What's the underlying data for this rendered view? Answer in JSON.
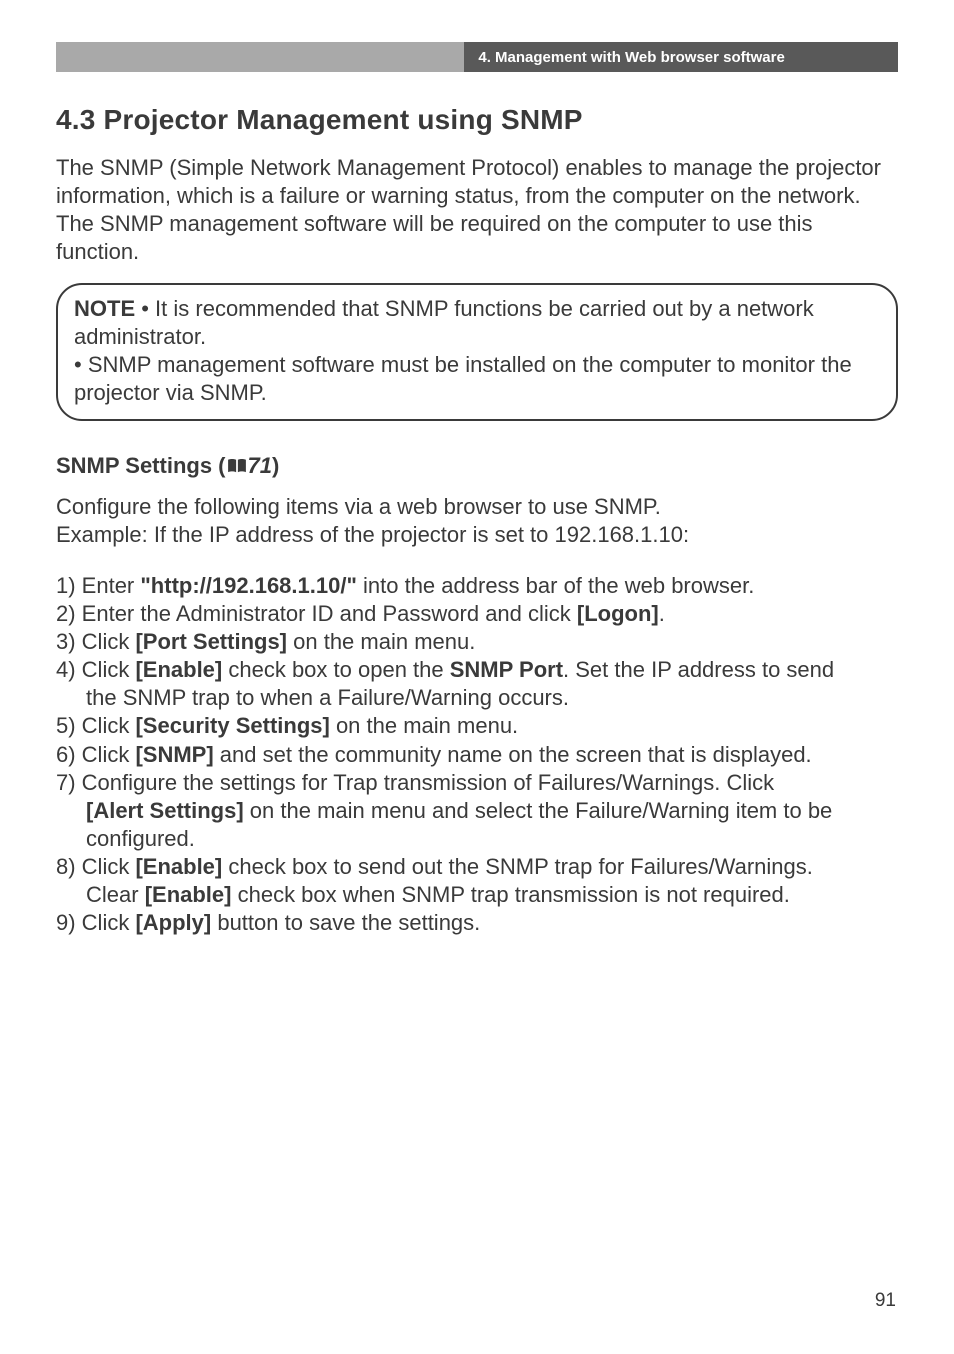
{
  "header": {
    "breadcrumb": "4. Management with Web browser software"
  },
  "section": {
    "title": "4.3 Projector Management using SNMP",
    "intro": "The SNMP (Simple Network Management Protocol) enables to manage the projector information, which is a failure or warning status, from the computer on the network. The SNMP management software will be required on the computer to use this function."
  },
  "note": {
    "label": "NOTE",
    "line1_rest": "  • It is recommended that SNMP functions be carried out by a network administrator.",
    "line2": "• SNMP management software must be installed on the computer to monitor the projector via SNMP."
  },
  "snmp": {
    "heading_prefix": "SNMP Settings (",
    "heading_ref": "71",
    "heading_suffix": ")",
    "configure_l1": "Configure the following items via a web browser to use SNMP.",
    "configure_l2": "Example: If the IP address of the projector is set to 192.168.1.10:"
  },
  "steps": {
    "s1_a": "1) Enter ",
    "s1_b": "\"http://192.168.1.10/\"",
    "s1_c": " into the address bar of the web browser.",
    "s2_a": "2) Enter the Administrator ID and Password and click ",
    "s2_b": "[Logon]",
    "s2_c": ".",
    "s3_a": "3) Click ",
    "s3_b": "[Port Settings]",
    "s3_c": " on the main menu.",
    "s4_a": "4) Click ",
    "s4_b": "[Enable]",
    "s4_c": " check box to open the ",
    "s4_d": "SNMP Port",
    "s4_e": ". Set the IP address to send ",
    "s4_f": "the SNMP trap to when a Failure/Warning occurs.",
    "s5_a": "5) Click ",
    "s5_b": "[Security Settings]",
    "s5_c": " on the main menu.",
    "s6_a": "6) Click ",
    "s6_b": "[SNMP]",
    "s6_c": " and set the community name on the screen that is displayed.",
    "s7_a": "7) Configure the settings for Trap transmission of Failures/Warnings. Click ",
    "s7_b": "[Alert Settings]",
    "s7_c": " on the main menu and select the Failure/Warning item to be ",
    "s7_d": "configured.",
    "s8_a": "8) Click ",
    "s8_b": "[Enable]",
    "s8_c": " check box to send out the SNMP trap for Failures/Warnings. ",
    "s8_d": "Clear ",
    "s8_e": "[Enable]",
    "s8_f": " check box when SNMP trap transmission is not required.",
    "s9_a": "9) Click ",
    "s9_b": "[Apply]",
    "s9_c": " button to save the settings."
  },
  "page_number": "91"
}
